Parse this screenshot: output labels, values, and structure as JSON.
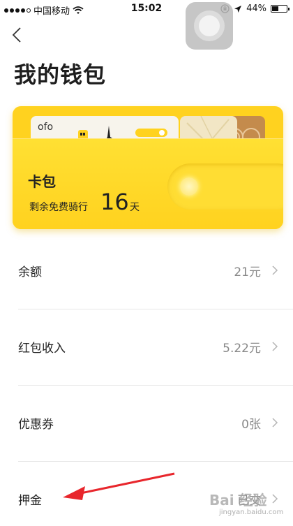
{
  "status_bar": {
    "carrier": "中国移动",
    "time": "15:02",
    "battery_percent": "44%",
    "battery_level": 0.44
  },
  "nav": {
    "title": "我的钱包"
  },
  "wallet_card": {
    "brand": "ofo",
    "title": "卡包",
    "free_ride_prefix": "剩余免费骑行",
    "free_ride_days": "16",
    "free_ride_unit": "天"
  },
  "list": [
    {
      "label": "余额",
      "value": "21元"
    },
    {
      "label": "红包收入",
      "value": "5.22元"
    },
    {
      "label": "优惠券",
      "value": "0张"
    },
    {
      "label": "押金",
      "value": "已交"
    }
  ],
  "watermark": {
    "text": "Bai 经验",
    "sub": "jingyan.baidu.com"
  },
  "colors": {
    "card_yellow": "#ffd21f",
    "annotation_red": "#e8262c"
  }
}
